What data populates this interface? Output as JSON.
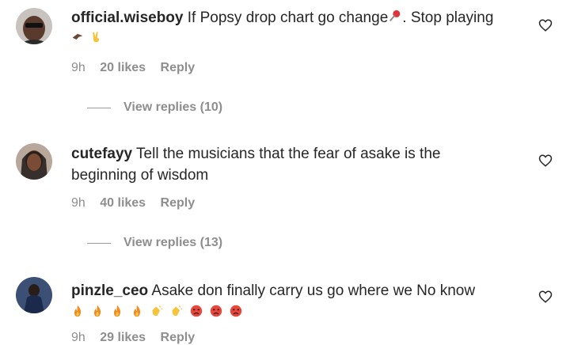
{
  "comments": [
    {
      "username": "official.wiseboy",
      "text": "If Popsy drop chart go change",
      "text_after": ". Stop playing",
      "time": "9h",
      "likes": "20 likes",
      "reply": "Reply",
      "view_replies": "View replies (10)",
      "emoji_inline": [
        "pushpin"
      ],
      "emoji_line": [
        "hawk",
        "victory-hand"
      ]
    },
    {
      "username": "cutefayy",
      "text": "Tell the musicians that the fear of asake is the",
      "text_line2": "beginning of wisdom",
      "time": "9h",
      "likes": "40 likes",
      "reply": "Reply",
      "view_replies": "View replies (13)"
    },
    {
      "username": "pinzle_ceo",
      "text": "Asake don finally carry us go where we No know",
      "time": "9h",
      "likes": "29 likes",
      "reply": "Reply",
      "emoji_line": [
        "fire",
        "fire",
        "fire",
        "fire",
        "clapping-hands",
        "clapping-hands",
        "pouting-face",
        "pouting-face",
        "pouting-face"
      ]
    }
  ],
  "colors": {
    "text": "#262626",
    "muted": "#8e8e8e",
    "fire": "#f28a1e",
    "clap": "#f6c33b",
    "pout": "#e8473b"
  }
}
